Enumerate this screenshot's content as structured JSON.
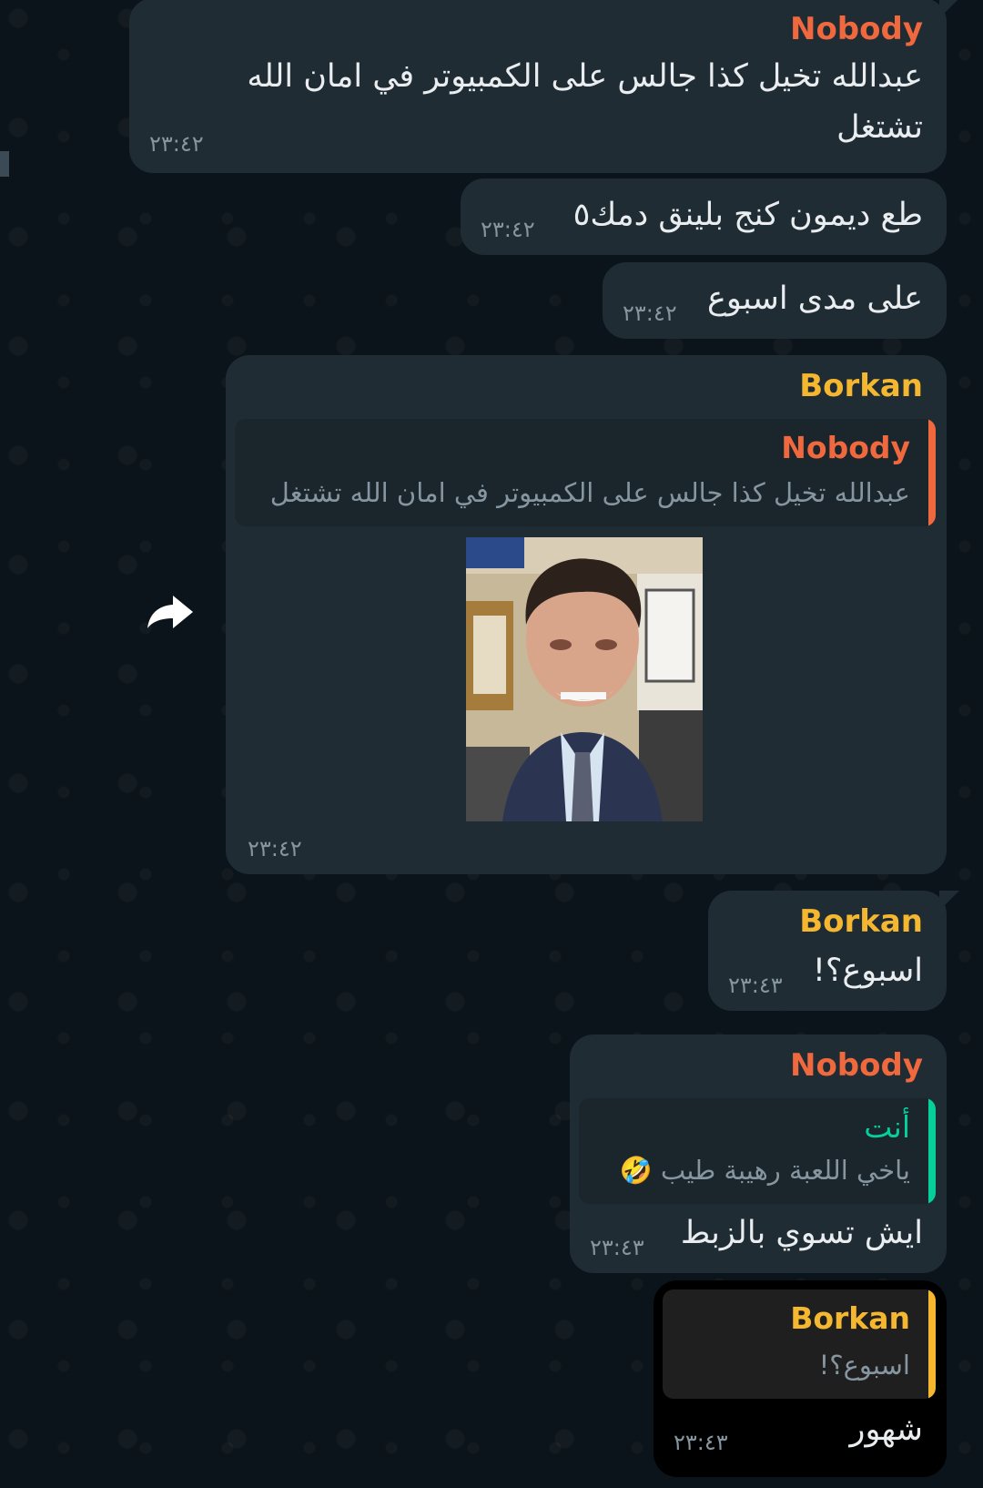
{
  "messages": [
    {
      "sender": "Nobody",
      "lines": [
        "عبدالله تخيل كذا جالس على الكمبيوتر في امان الله",
        "تشتغل"
      ],
      "time": "٢٣:٤٢"
    },
    {
      "text": "طع ديمون كنج بلينق دمك٥",
      "time": "٢٣:٤٢"
    },
    {
      "text": "على مدى اسبوع",
      "time": "٢٣:٤٢"
    },
    {
      "sender": "Borkan",
      "reply": {
        "name": "Nobody",
        "text": "عبدالله تخيل كذا جالس على الكمبيوتر في امان الله تشتغل"
      },
      "photo": "office-cringe-face",
      "time": "٢٣:٤٢"
    },
    {
      "sender": "Borkan",
      "text": "اسبوع؟!",
      "time": "٢٣:٤٣"
    },
    {
      "sender": "Nobody",
      "reply": {
        "name": "أنت",
        "text": "ياخي اللعبة رهيبة طيب",
        "emoji": "🤣"
      },
      "text": "ايش تسوي بالزبط",
      "time": "٢٣:٤٣"
    },
    {
      "reply": {
        "name": "Borkan",
        "text": "اسبوع؟!"
      },
      "text": "شهور",
      "time": "٢٣:٤٣"
    }
  ],
  "icons": {
    "forward": "forward-arrow-icon"
  },
  "colors": {
    "background": "#0b141a",
    "bubble": "#1f2c34",
    "nobody": "#f0683d",
    "borkan": "#f5b72f",
    "you": "#06cf9c",
    "timestamp": "#8696a0"
  }
}
